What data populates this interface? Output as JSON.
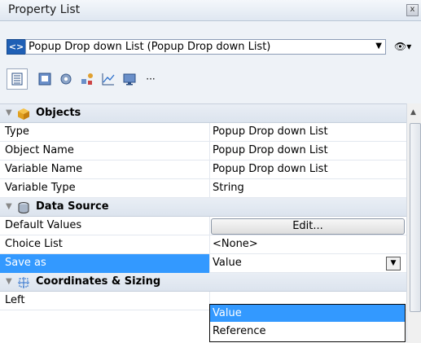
{
  "window": {
    "title": "Property List",
    "close_glyph": "x"
  },
  "selector": {
    "nav_glyph": "<>",
    "value": "Popup Drop down List (Popup Drop down List)",
    "arrow_glyph": "▼",
    "eye_glyph": "👁▾"
  },
  "toolbar": {
    "icons": [
      "properties-list-icon",
      "display-icon",
      "gear-icon",
      "shapes-icon",
      "chart-icon",
      "monitor-icon",
      "more-icon"
    ],
    "more_glyph": "···"
  },
  "categories": {
    "objects": "Objects",
    "data_source": "Data Source",
    "coords": "Coordinates & Sizing"
  },
  "properties": {
    "type": {
      "name": "Type",
      "value": "Popup Drop down List"
    },
    "object_name": {
      "name": "Object Name",
      "value": "Popup Drop down List"
    },
    "variable_name": {
      "name": "Variable Name",
      "value": "Popup Drop down List"
    },
    "variable_type": {
      "name": "Variable Type",
      "value": "String"
    },
    "default_values": {
      "name": "Default Values",
      "button": "Edit..."
    },
    "choice_list": {
      "name": "Choice List",
      "value": "<None>"
    },
    "save_as": {
      "name": "Save as",
      "value": "Value"
    },
    "left": {
      "name": "Left"
    }
  },
  "dropdown": {
    "options": [
      "Value",
      "Reference"
    ],
    "selected_index": 0
  },
  "colors": {
    "selection": "#3399ff",
    "category_bg": "#dce4ee"
  }
}
